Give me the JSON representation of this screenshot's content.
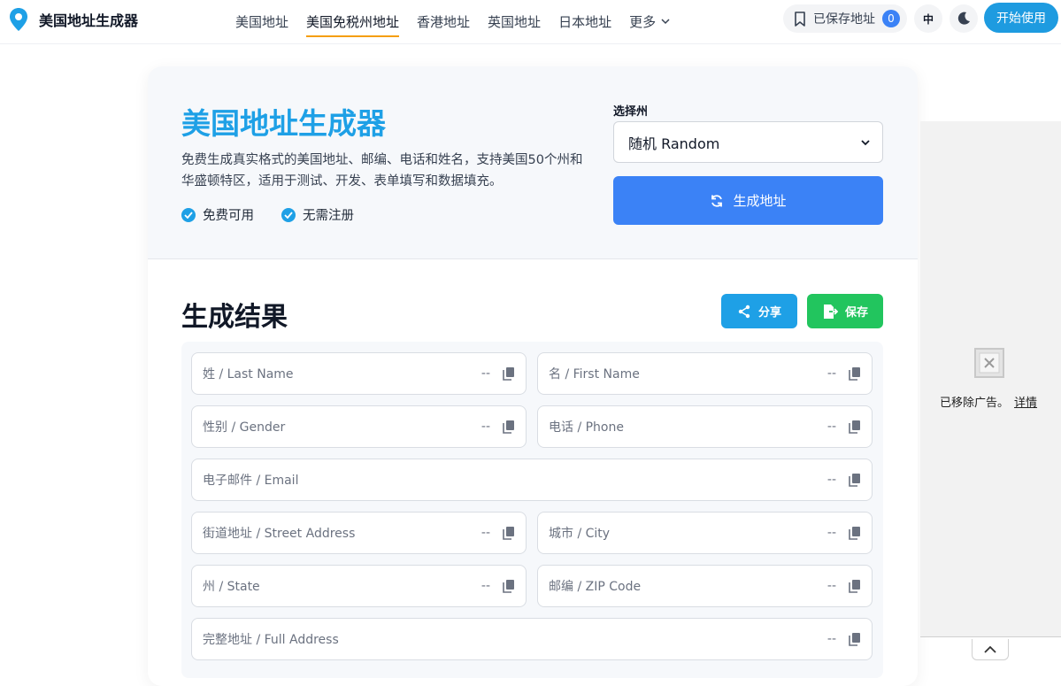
{
  "brand": {
    "name": "美国地址生成器"
  },
  "nav": {
    "items": [
      {
        "label": "美国地址",
        "active": false
      },
      {
        "label": "美国免税州地址",
        "active": true
      },
      {
        "label": "香港地址",
        "active": false
      },
      {
        "label": "英国地址",
        "active": false
      },
      {
        "label": "日本地址",
        "active": false
      }
    ],
    "more_label": "更多"
  },
  "header": {
    "saved_label": "已保存地址",
    "saved_count": "0",
    "lang_label": "中",
    "start_label": "开始使用"
  },
  "hero": {
    "title": "美国地址生成器",
    "description": "免费生成真实格式的美国地址、邮编、电话和姓名，支持美国50个州和华盛顿特区，适用于测试、开发、表单填写和数据填充。",
    "features": [
      "免费可用",
      "无需注册"
    ],
    "state_label": "选择州",
    "state_selected": "随机 Random",
    "generate_label": "生成地址"
  },
  "result": {
    "title": "生成结果",
    "share_label": "分享",
    "save_label": "保存",
    "fields": [
      {
        "label": "姓 / Last Name",
        "value": "--"
      },
      {
        "label": "名 / First Name",
        "value": "--"
      },
      {
        "label": "性别 / Gender",
        "value": "--"
      },
      {
        "label": "电话 / Phone",
        "value": "--"
      },
      {
        "label": "电子邮件 / Email",
        "value": "--"
      },
      {
        "label": "街道地址 / Street Address",
        "value": "--"
      },
      {
        "label": "城市 / City",
        "value": "--"
      },
      {
        "label": "州 / State",
        "value": "--"
      },
      {
        "label": "邮编 / ZIP Code",
        "value": "--"
      },
      {
        "label": "完整地址 / Full Address",
        "value": "--"
      }
    ]
  },
  "ad": {
    "removed_text": "已移除广告。",
    "details_link": "详情"
  },
  "colors": {
    "accent": "#1ea0e6",
    "primary_button": "#3b82f6",
    "save_button": "#22c55e",
    "nav_underline": "#f59e0b"
  },
  "icons": [
    "map-pin-icon",
    "bookmark-icon",
    "moon-icon",
    "chevron-down-icon",
    "check-circle-icon",
    "refresh-icon",
    "share-icon",
    "save-icon",
    "copy-icon",
    "broken-image-icon",
    "chevron-up-icon"
  ]
}
